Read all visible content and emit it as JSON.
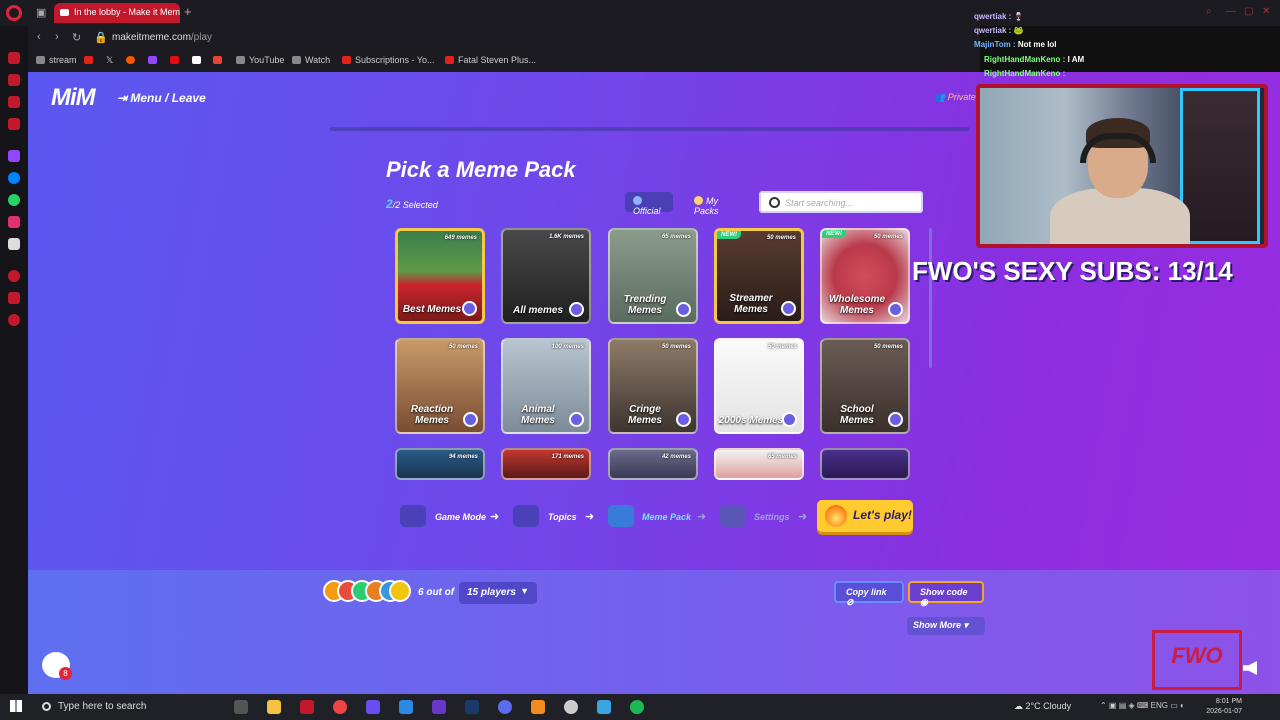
{
  "browser": {
    "tab_title": "In the lobby - Make it Mem",
    "url_host": "makeitmeme.com",
    "url_path": "/play",
    "bookmarks": [
      {
        "label": "stream",
        "color": "#aaa"
      },
      {
        "label": "YouTube",
        "color": "#aaa"
      },
      {
        "label": "Watch",
        "color": "#aaa"
      },
      {
        "label": "Subscriptions - Yo...",
        "color": "#e62117"
      },
      {
        "label": "Fatal Steven Plus...",
        "color": "#e62117"
      }
    ]
  },
  "app": {
    "logo": "MiM",
    "menu_leave": "Menu / Leave",
    "private": "Private"
  },
  "picker": {
    "title": "Pick a Meme Pack",
    "selected_count": "2",
    "selected_total": "/2 Selected",
    "tab_official": "Official",
    "tab_mypacks": "My Packs",
    "search_placeholder": "Start searching..."
  },
  "packs": [
    {
      "name": "Best Memes",
      "count": "649 memes",
      "tag": "",
      "selected": true,
      "bg": "linear-gradient(180deg,#3b7d4c 0%,#5e9a48 45%,#c9232d 60%,#7a1b1b 100%)"
    },
    {
      "name": "All memes",
      "count": "1.6K memes",
      "tag": "",
      "selected": false,
      "bg": "linear-gradient(180deg,#4a4a4a,#202020)"
    },
    {
      "name": "Trending Memes",
      "count": "65 memes",
      "tag": "",
      "selected": false,
      "bg": "linear-gradient(180deg,#8c9c8c,#5a6b5f)"
    },
    {
      "name": "Streamer Memes",
      "count": "50 memes",
      "tag": "NEW!",
      "selected": true,
      "bg": "linear-gradient(180deg,#5a3c30,#2a1c18)"
    },
    {
      "name": "Wholesome Memes",
      "count": "50 memes",
      "tag": "NEW!",
      "selected": false,
      "bg": "radial-gradient(circle,#d24e5c 0%,#b9394a 50%,#e6d6d8 100%)"
    },
    {
      "name": "Reaction Memes",
      "count": "50 memes",
      "tag": "",
      "selected": false,
      "bg": "linear-gradient(180deg,#c89a6a,#7a4d32)"
    },
    {
      "name": "Animal Memes",
      "count": "100 memes",
      "tag": "",
      "selected": false,
      "bg": "linear-gradient(180deg,#b8c4d0,#7d8b98)"
    },
    {
      "name": "Cringe Memes",
      "count": "50 memes",
      "tag": "",
      "selected": false,
      "bg": "linear-gradient(180deg,#8e7a68,#3d3530)"
    },
    {
      "name": "2000s Memes",
      "count": "50 memes",
      "tag": "",
      "selected": false,
      "bg": "linear-gradient(180deg,#fafafa,#e3e3e3)"
    },
    {
      "name": "School Memes",
      "count": "50 memes",
      "tag": "",
      "selected": false,
      "bg": "linear-gradient(180deg,#6b5b55,#3a302c)"
    },
    {
      "name": "",
      "count": "94 memes",
      "tag": "",
      "selected": false,
      "bg": "linear-gradient(180deg,#2a5c88,#1a3350)"
    },
    {
      "name": "",
      "count": "171 memes",
      "tag": "",
      "selected": false,
      "bg": "linear-gradient(180deg,#c2382f,#5a1a1a)"
    },
    {
      "name": "",
      "count": "42 memes",
      "tag": "",
      "selected": false,
      "bg": "linear-gradient(180deg,#6b6b8a,#3a3a55)"
    },
    {
      "name": "",
      "count": "65 memes",
      "tag": "",
      "selected": false,
      "bg": "linear-gradient(180deg,#f2f2f2,#e0a0a0)"
    },
    {
      "name": "",
      "count": "",
      "tag": "",
      "selected": false,
      "bg": "linear-gradient(180deg,#4a2f8a,#2a1a55)"
    }
  ],
  "steps": [
    {
      "label": "Game Mode",
      "color": "#ffffff"
    },
    {
      "label": "Topics",
      "color": "#ffffff"
    },
    {
      "label": "Meme Pack",
      "color": "#7fe0ff"
    },
    {
      "label": "Settings",
      "color": "#a39ee0"
    }
  ],
  "play_label": "Let's play!",
  "lobby": {
    "players_prefix": "6 out of",
    "players_max": "15 players",
    "copy_link": "Copy link",
    "show_code": "Show code",
    "show_more": "Show More",
    "chat_badge": "8"
  },
  "overlay": {
    "chat": [
      {
        "user": "qwertiak :",
        "msg": "",
        "color": "#c7b6ff"
      },
      {
        "user": "qwertiak :",
        "msg": "",
        "color": "#c7b6ff"
      },
      {
        "user": "MajinTom :",
        "msg": "Not me lol",
        "color": "#6fb7ff"
      },
      {
        "user": "RightHandManKeno :",
        "msg": "I AM",
        "color": "#7fff7f"
      },
      {
        "user": "RightHandManKeno :",
        "msg": "",
        "color": "#7fff7f"
      }
    ],
    "subs_goal": "FWO'S SEXY SUBS: 13/14",
    "stamp": "FWO"
  },
  "taskbar": {
    "search_placeholder": "Type here to search",
    "weather": "2°C  Cloudy",
    "lang": "ENG",
    "time": "8:01 PM",
    "date": "2026-01-07"
  }
}
